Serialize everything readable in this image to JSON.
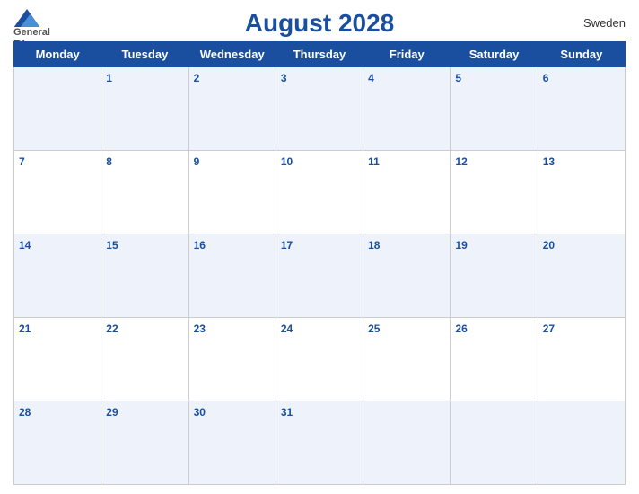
{
  "header": {
    "title": "August 2028",
    "country": "Sweden",
    "logo": {
      "general": "General",
      "blue": "Blue"
    }
  },
  "days": [
    "Monday",
    "Tuesday",
    "Wednesday",
    "Thursday",
    "Friday",
    "Saturday",
    "Sunday"
  ],
  "weeks": [
    [
      "",
      "1",
      "2",
      "3",
      "4",
      "5",
      "6"
    ],
    [
      "7",
      "8",
      "9",
      "10",
      "11",
      "12",
      "13"
    ],
    [
      "14",
      "15",
      "16",
      "17",
      "18",
      "19",
      "20"
    ],
    [
      "21",
      "22",
      "23",
      "24",
      "25",
      "26",
      "27"
    ],
    [
      "28",
      "29",
      "30",
      "31",
      "",
      "",
      ""
    ]
  ]
}
